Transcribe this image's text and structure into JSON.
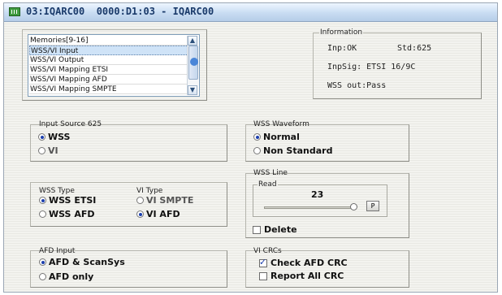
{
  "window": {
    "title": "03:IQARC00  0000:D1:03 - IQARC00",
    "icon": "window-app-icon"
  },
  "memories": {
    "items": [
      "Memories[9-16]",
      "WSS/VI Input",
      "WSS/VI Output",
      "WSS/VI Mapping ETSI",
      "WSS/VI Mapping AFD",
      "WSS/VI Mapping SMPTE"
    ],
    "selected_index": 1
  },
  "information": {
    "label": "Information",
    "inp_status": "Inp:OK",
    "std": "Std:625",
    "inpsig": "InpSig: ETSI 16/9C",
    "wss_out": "WSS out:Pass"
  },
  "input_source": {
    "label": "Input Source 625",
    "options": [
      "WSS",
      "VI"
    ],
    "selected": "WSS"
  },
  "wss_waveform": {
    "label": "WSS Waveform",
    "options": [
      "Normal",
      "Non Standard"
    ],
    "selected": "Normal"
  },
  "wss_type": {
    "label": "WSS Type",
    "options": [
      "WSS ETSI",
      "WSS AFD"
    ],
    "selected": "WSS ETSI"
  },
  "vi_type": {
    "label": "VI Type",
    "options": [
      "VI SMPTE",
      "VI AFD"
    ],
    "selected": "VI AFD"
  },
  "wss_line": {
    "label": "WSS Line",
    "read_label": "Read",
    "value": "23",
    "p_label": "P",
    "delete_label": "Delete",
    "delete_checked": false
  },
  "afd_input": {
    "label": "AFD Input",
    "options": [
      "AFD & ScanSys",
      "AFD only"
    ],
    "selected": "AFD & ScanSys"
  },
  "vi_crcs": {
    "label": "VI CRCs",
    "check_afd_crc": "Check AFD CRC",
    "check_afd_crc_checked": true,
    "report_all_crc": "Report All CRC",
    "report_all_crc_checked": false
  },
  "colors": {
    "accent": "#1c3fae",
    "titlebar": "#c8dcf2",
    "selection": "#cfe3f7"
  }
}
